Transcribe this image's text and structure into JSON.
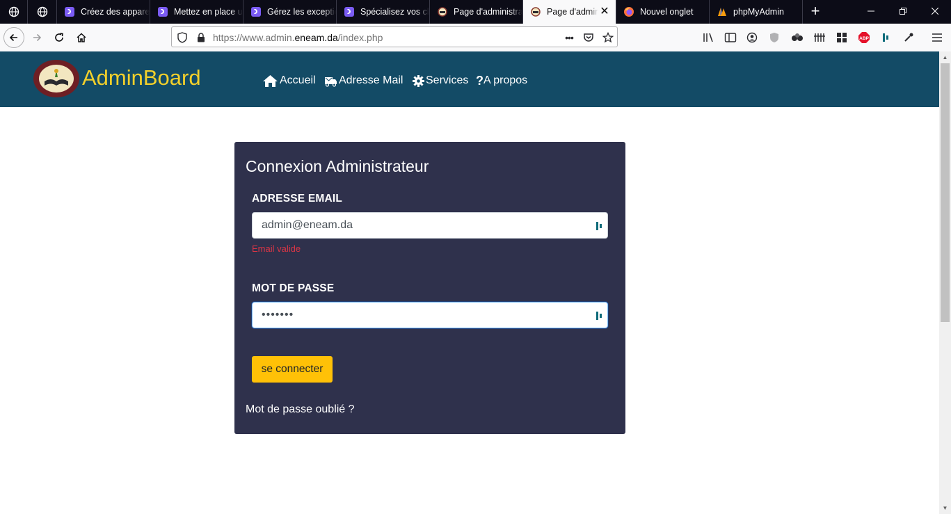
{
  "browser": {
    "tabs": [
      {
        "label": "",
        "icon": "globe-icon"
      },
      {
        "label": "",
        "icon": "globe-icon"
      },
      {
        "label": "Créez des appareils",
        "icon": "d-logo-icon"
      },
      {
        "label": "Mettez en place une",
        "icon": "d-logo-icon"
      },
      {
        "label": "Gérez les exceptions",
        "icon": "d-logo-icon"
      },
      {
        "label": "Spécialisez vos classes",
        "icon": "d-logo-icon"
      },
      {
        "label": "Page d'administration",
        "icon": "school-logo-icon"
      },
      {
        "label": "Page d'administration",
        "icon": "school-logo-icon",
        "active": true
      },
      {
        "label": "Nouvel onglet",
        "icon": "firefox-icon"
      },
      {
        "label": "phpMyAdmin",
        "icon": "phpmyadmin-icon"
      }
    ],
    "url_prefix": "https://www.admin.",
    "url_domain": "eneam.da",
    "url_path": "/index.php"
  },
  "header": {
    "brand": "AdminBoard",
    "menu": {
      "home": "Accueil",
      "mail": "Adresse Mail",
      "services": "Services",
      "about": "A propos"
    }
  },
  "login": {
    "title": "Connexion Administrateur",
    "email_label": "ADRESSE EMAIL",
    "email_value": "admin@eneam.da",
    "email_status": "Email valide",
    "password_label": "MOT DE PASSE",
    "password_value": "•••••••",
    "submit": "se connecter",
    "forgot": "Mot de passe oublié ?"
  },
  "colors": {
    "header_bg": "#134b66",
    "brand": "#f3d02b",
    "card_bg": "#2f314c",
    "button": "#ffc107",
    "error_text": "#dc3545"
  }
}
